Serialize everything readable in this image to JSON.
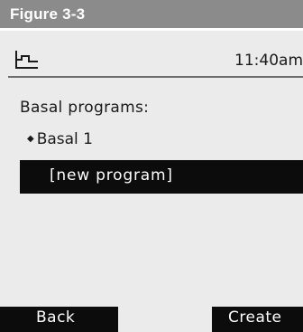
{
  "figure": {
    "label": "Figure 3-3"
  },
  "status_bar": {
    "icon": "basal-rate-icon",
    "time": "11:40am"
  },
  "main": {
    "section_title": "Basal programs:",
    "programs": [
      {
        "bullet": "◆",
        "label": "Basal 1"
      }
    ],
    "selected_option": "[new program]"
  },
  "softkeys": {
    "left": "Back",
    "right": "Create"
  },
  "colors": {
    "header": "#8b8b8b",
    "screen": "#ebebeb",
    "highlight": "#0c0c0c",
    "text": "#1a1a1a"
  }
}
